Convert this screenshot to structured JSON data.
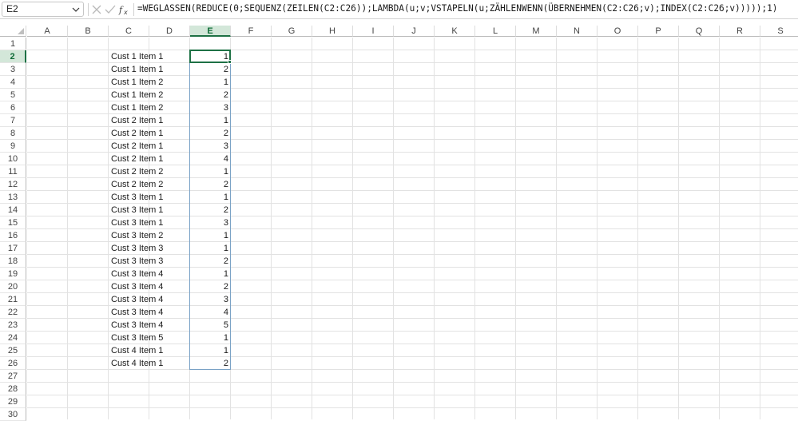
{
  "formula_bar": {
    "name_box": "E2",
    "formula": "=WEGLASSEN(REDUCE(0;SEQUENZ(ZEILEN(C2:C26));LAMBDA(u;v;VSTAPELN(u;ZÄHLENWENN(ÜBERNEHMEN(C2:C26;v);INDEX(C2:C26;v)))));1)",
    "icons": [
      "chevron-down-icon",
      "cancel-icon",
      "enter-icon",
      "function-icon"
    ]
  },
  "sheet": {
    "columns": [
      "A",
      "B",
      "C",
      "D",
      "E",
      "F",
      "G",
      "H",
      "I",
      "J",
      "K",
      "L",
      "M",
      "N",
      "O",
      "P",
      "Q",
      "R",
      "S"
    ],
    "active_column": "E",
    "rows": [
      "1",
      "2",
      "3",
      "4",
      "5",
      "6",
      "7",
      "8",
      "9",
      "10",
      "11",
      "12",
      "13",
      "14",
      "15",
      "16",
      "17",
      "18",
      "19",
      "20",
      "21",
      "22",
      "23",
      "24",
      "25",
      "26",
      "27",
      "28",
      "29",
      "30"
    ],
    "active_row": "2",
    "column_c": [
      "Cust 1 Item 1",
      "Cust 1 Item 1",
      "Cust 1 Item 2",
      "Cust 1 Item 2",
      "Cust 1 Item 2",
      "Cust 2 Item 1",
      "Cust 2 Item 1",
      "Cust 2 Item 1",
      "Cust 2 Item 1",
      "Cust 2 Item 2",
      "Cust 2 Item 2",
      "Cust 3 Item 1",
      "Cust 3 Item 1",
      "Cust 3 Item 1",
      "Cust 3 Item 2",
      "Cust 3 Item 3",
      "Cust 3 Item 3",
      "Cust 3 Item 4",
      "Cust 3 Item 4",
      "Cust 3 Item 4",
      "Cust 3 Item 4",
      "Cust 3 Item 4",
      "Cust 3 Item 5",
      "Cust 4 Item 1",
      "Cust 4 Item 1"
    ],
    "column_e": [
      "1",
      "2",
      "1",
      "2",
      "3",
      "1",
      "2",
      "3",
      "4",
      "1",
      "2",
      "1",
      "2",
      "3",
      "1",
      "1",
      "2",
      "1",
      "2",
      "3",
      "4",
      "5",
      "1",
      "1",
      "2"
    ]
  },
  "colors": {
    "accent": "#1e7145",
    "header_active_bg": "#d3e7d9",
    "spill_border": "#7aa2c6",
    "gridline": "#e2e2e2"
  }
}
